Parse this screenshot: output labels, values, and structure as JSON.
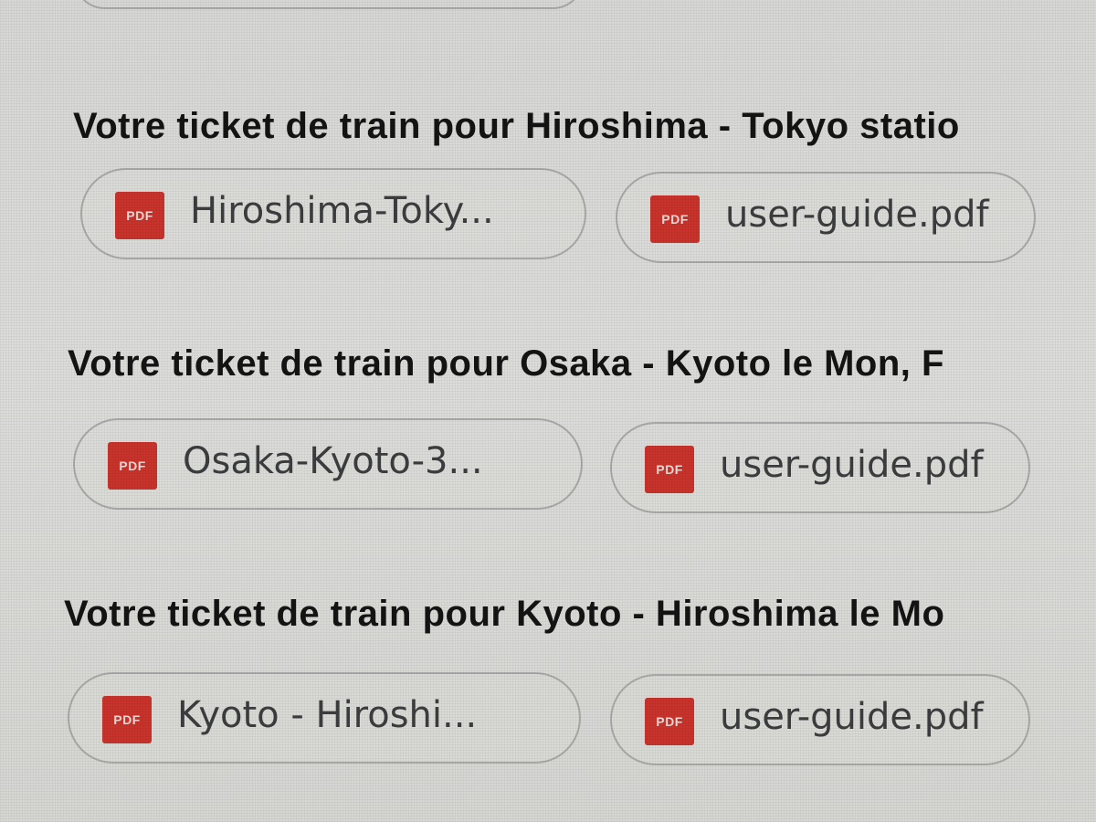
{
  "threads": [
    {
      "title": "Votre ticket de train pour Hiroshima - Tokyo statio",
      "attachments": [
        {
          "type_label": "PDF",
          "filename": "Hiroshima-Toky..."
        },
        {
          "type_label": "PDF",
          "filename": "user-guide.pdf"
        }
      ]
    },
    {
      "title": "Votre ticket de train pour Osaka - Kyoto le Mon, F",
      "attachments": [
        {
          "type_label": "PDF",
          "filename": "Osaka-Kyoto-3..."
        },
        {
          "type_label": "PDF",
          "filename": "user-guide.pdf"
        }
      ]
    },
    {
      "title": "Votre ticket de train pour Kyoto - Hiroshima le Mo",
      "attachments": [
        {
          "type_label": "PDF",
          "filename": "Kyoto - Hiroshi..."
        },
        {
          "type_label": "PDF",
          "filename": "user-guide.pdf"
        }
      ]
    }
  ],
  "colors": {
    "background": "#d9dad8",
    "title_text": "#141414",
    "chip_border": "#a9aaa7",
    "chip_text": "#3c3d3f",
    "pdf_icon": "#c8332b"
  },
  "icons": {
    "attachment_type": "pdf-file-icon"
  }
}
